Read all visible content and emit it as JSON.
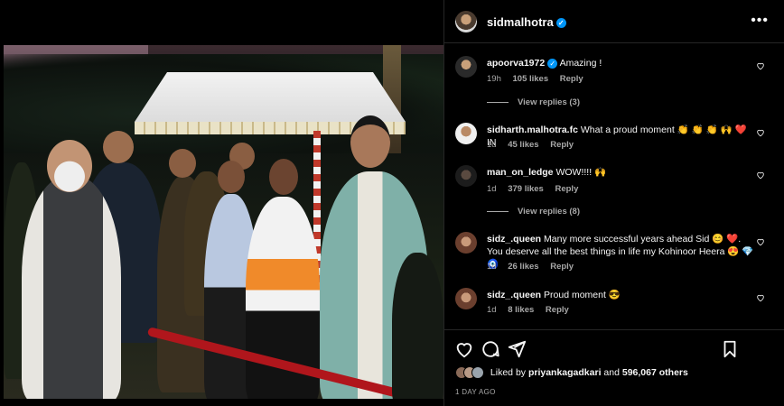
{
  "post": {
    "username": "sidmalhotra",
    "more_label": "•••"
  },
  "comments": [
    {
      "username": "apoorva1972",
      "text": "Amazing !",
      "time": "19h",
      "likes": "105 likes",
      "reply_label": "Reply",
      "view_replies": "View replies (3)"
    },
    {
      "username": "sidharth.malhotra.fc",
      "text": "What a proud moment 👏 👏 👏 🙌 ❤️ IN",
      "time": "1d",
      "likes": "45 likes",
      "reply_label": "Reply"
    },
    {
      "username": "man_on_ledge",
      "text": "WOW!!!! 🙌",
      "time": "1d",
      "likes": "379 likes",
      "reply_label": "Reply",
      "view_replies": "View replies (8)"
    },
    {
      "username": "sidz_.queen",
      "text": "Many more successful years ahead Sid 😊 ❤️. You deserve all the best things in life my Kohinoor Heera 😍 💎 🧿",
      "time": "1d",
      "likes": "26 likes",
      "reply_label": "Reply"
    },
    {
      "username": "sidz_.queen",
      "text": "Proud moment 😎",
      "time": "1d",
      "likes": "8 likes",
      "reply_label": "Reply"
    }
  ],
  "likes_summary": {
    "prefix": "Liked by",
    "user": "priyankagadkari",
    "joiner": "and",
    "count": "596,067 others"
  },
  "timestamp": "1 DAY AGO",
  "colors": {
    "background": "#000000",
    "text": "#f5f5f5",
    "muted": "#a8a8a8",
    "verified": "#0095f6",
    "divider": "#262626"
  },
  "icons": {
    "like": "heart-icon",
    "comment": "comment-icon",
    "share": "share-icon",
    "save": "bookmark-icon",
    "verified": "verified-badge-icon",
    "more": "more-options-icon"
  }
}
